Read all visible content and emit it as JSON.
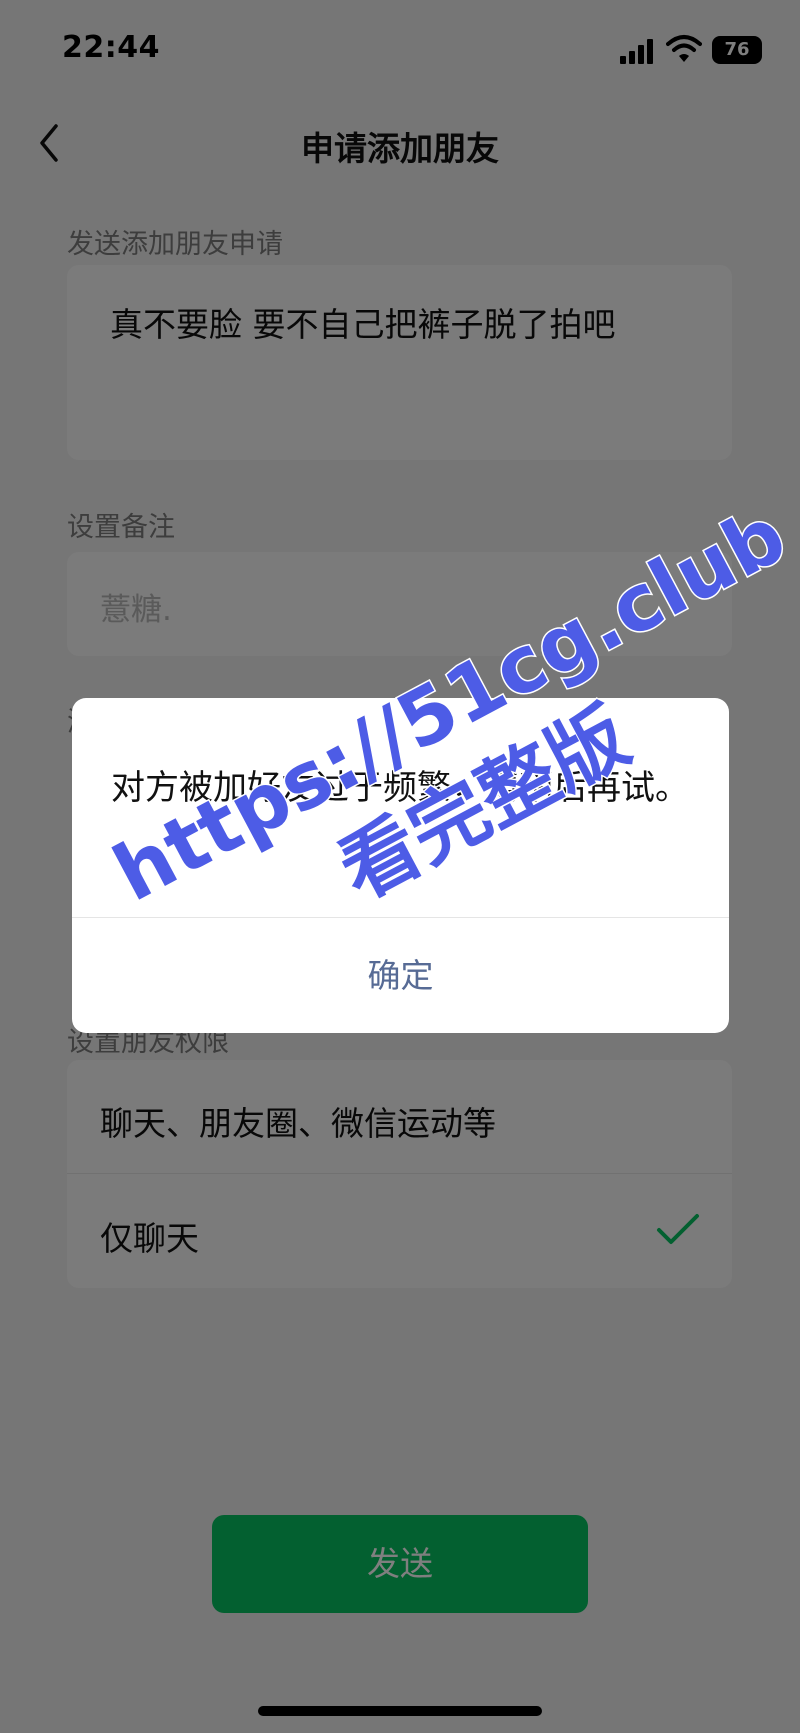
{
  "status_bar": {
    "time": "22:44",
    "battery": "76"
  },
  "header": {
    "title": "申请添加朋友"
  },
  "request": {
    "label": "发送添加朋友申请",
    "message": "真不要脸 要不自己把裤子脱了拍吧"
  },
  "remark": {
    "label": "设置备注",
    "placeholder": "薏糖."
  },
  "hidden_label": "添",
  "permissions": {
    "label": "设置朋友权限",
    "options": [
      "聊天、朋友圈、微信运动等",
      "仅聊天"
    ],
    "selected": "仅聊天"
  },
  "send_label": "发送",
  "dialog": {
    "message": "对方被加好友过于频繁，请稍后再试。",
    "confirm_label": "确定"
  },
  "watermark": {
    "url": "https://51cg.club",
    "text": "看完整版"
  },
  "colors": {
    "accent": "#07c160",
    "link": "#576b95",
    "watermark": "#4d5ce6"
  }
}
